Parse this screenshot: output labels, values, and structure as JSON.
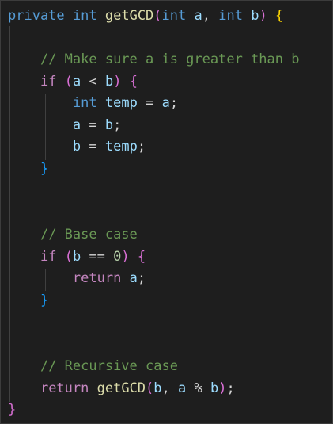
{
  "code": {
    "l1": {
      "kw_private": "private",
      "kw_int": "int",
      "fn_name": "getGCD",
      "open_paren": "(",
      "kw_int_a": "int",
      "param_a": "a",
      "comma": ",",
      "kw_int_b": "int",
      "param_b": "b",
      "close_paren": ")",
      "open_brace": "{"
    },
    "l3": {
      "comment": "// Make sure a is greater than b"
    },
    "l4": {
      "kw_if": "if",
      "open_paren": "(",
      "var_a": "a",
      "op": "<",
      "var_b": "b",
      "close_paren": ")",
      "open_brace": "{"
    },
    "l5": {
      "kw_int": "int",
      "var_temp": "temp",
      "op": "=",
      "var_a": "a",
      "semi": ";"
    },
    "l6": {
      "var_a": "a",
      "op": "=",
      "var_b": "b",
      "semi": ";"
    },
    "l7": {
      "var_b": "b",
      "op": "=",
      "var_temp": "temp",
      "semi": ";"
    },
    "l8": {
      "close_brace": "}"
    },
    "l11": {
      "comment": "// Base case"
    },
    "l12": {
      "kw_if": "if",
      "open_paren": "(",
      "var_b": "b",
      "op": "==",
      "num": "0",
      "close_paren": ")",
      "open_brace": "{"
    },
    "l13": {
      "kw_return": "return",
      "var_a": "a",
      "semi": ";"
    },
    "l14": {
      "close_brace": "}"
    },
    "l17": {
      "comment": "// Recursive case"
    },
    "l18": {
      "kw_return": "return",
      "fn_name": "getGCD",
      "open_paren": "(",
      "var_b": "b",
      "comma": ",",
      "var_a": "a",
      "op": "%",
      "var_b2": "b",
      "close_paren": ")",
      "semi": ";"
    },
    "l19": {
      "close_brace": "}"
    }
  }
}
